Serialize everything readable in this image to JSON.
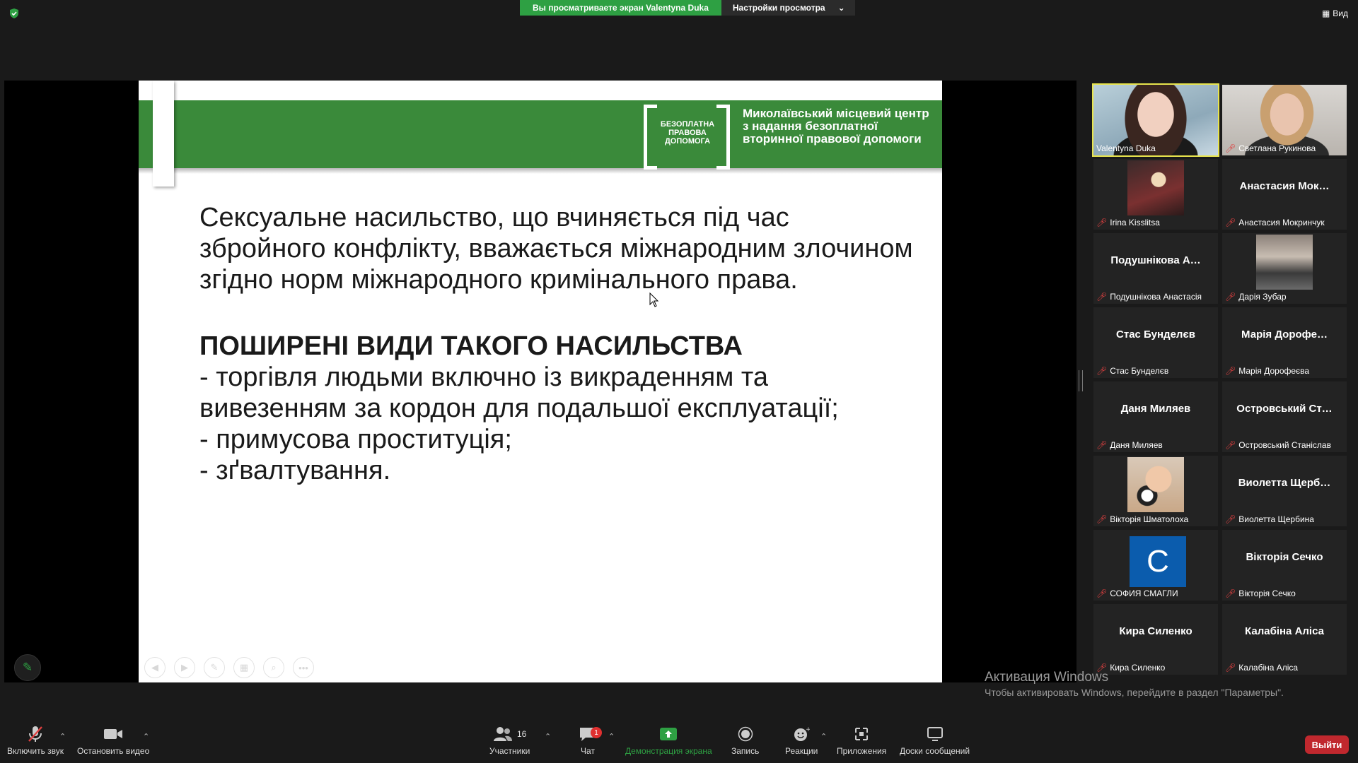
{
  "top_bar": {
    "share_banner": "Вы просматриваете экран Valentyna Duka",
    "view_options": "Настройки просмотра",
    "view_button": "Вид"
  },
  "slide": {
    "logo_text": "БЕЗОПЛАТНА ПРАВОВА ДОПОМОГА",
    "header_org": "Миколаївський місцевий центр з надання безоплатної вторинної правової допомоги",
    "paragraph": "Сексуальне насильство, що вчиняється під час збройного конфлікту, вважається міжнародним злочином згідно норм міжнародного кримінального права.",
    "heading": "ПОШИРЕНІ ВИДИ ТАКОГО НАСИЛЬСТВА",
    "items": [
      "- торгівля людьми включно із викраденням та вивезенням за кордон для подальшої експлуатації;",
      "- примусова проституція;",
      "- зґвалтування."
    ]
  },
  "participants": [
    {
      "name": "Valentyna Duka",
      "big": "",
      "kind": "video"
    },
    {
      "name": "Светлана Рукинова",
      "big": "",
      "kind": "video"
    },
    {
      "name": "Irina Kisslitsa",
      "big": "",
      "kind": "photo"
    },
    {
      "name": "Анастасия Мокринчук",
      "big": "Анастасия  Мок…",
      "kind": "name"
    },
    {
      "name": "Подушнікова Анастасія",
      "big": "Подушнікова А…",
      "kind": "name"
    },
    {
      "name": "Дарія Зубар",
      "big": "",
      "kind": "photo"
    },
    {
      "name": "Стас Бунделєв",
      "big": "Стас Бунделєв",
      "kind": "name"
    },
    {
      "name": "Марія Дорофеєва",
      "big": "Марія Дорофе…",
      "kind": "name"
    },
    {
      "name": "Даня Миляев",
      "big": "Даня Миляев",
      "kind": "name"
    },
    {
      "name": "Островський Станіслав",
      "big": "Островський Ст…",
      "kind": "name"
    },
    {
      "name": "Вікторія Шматолоха",
      "big": "",
      "kind": "photo"
    },
    {
      "name": "Виолетта Щербина",
      "big": "Виолетта  Щерб…",
      "kind": "name"
    },
    {
      "name": "СОФИЯ СМАГЛИ",
      "big": "C",
      "kind": "avatar"
    },
    {
      "name": "Вікторія Сечко",
      "big": "Вікторія Сечко",
      "kind": "name"
    },
    {
      "name": "Кира Силенко",
      "big": "Кира Силенко",
      "kind": "name"
    },
    {
      "name": "Калабіна Аліса",
      "big": "Калабіна Аліса",
      "kind": "name"
    }
  ],
  "watermark": {
    "title": "Активация Windows",
    "subtitle": "Чтобы активировать Windows, перейдите в раздел \"Параметры\"."
  },
  "toolbar": {
    "unmute": "Включить звук",
    "start_video": "Остановить видео",
    "participants": "Участники",
    "participants_count": "16",
    "chat": "Чат",
    "chat_badge": "1",
    "share": "Демонстрация экрана",
    "record": "Запись",
    "reactions": "Реакции",
    "apps": "Приложения",
    "whiteboards": "Доски сообщений",
    "leave": "Выйти"
  },
  "colors": {
    "share_green": "#2ea043",
    "slide_header_green": "#3a8a3a",
    "active_speaker": "#e8e44d",
    "leave_red": "#c0282e"
  }
}
